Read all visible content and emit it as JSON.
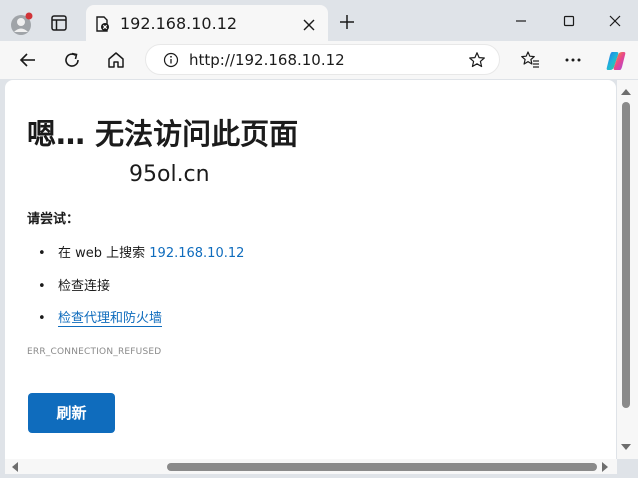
{
  "tab": {
    "title": "192.168.10.12"
  },
  "address_bar": {
    "url": "http://192.168.10.12"
  },
  "error": {
    "title": "嗯… 无法访问此页面",
    "host": "95ol.cn",
    "try_label": "请尝试：",
    "suggestions": [
      {
        "text": "在 web 上搜索 ",
        "link": "192.168.10.12"
      },
      {
        "text": "检查连接"
      },
      {
        "link": "检查代理和防火墙"
      }
    ],
    "code": "ERR_CONNECTION_REFUSED",
    "refresh_label": "刷新"
  },
  "colors": {
    "accent": "#0f6cbd",
    "frame": "#dfe3e8",
    "toolbar": "#f7f7f7"
  }
}
